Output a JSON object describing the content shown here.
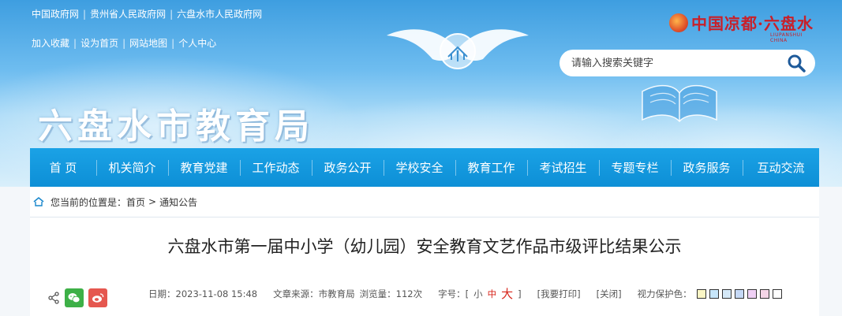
{
  "top_links": [
    "中国政府网",
    "贵州省人民政府网",
    "六盘水市人民政府网"
  ],
  "user_links": [
    "加入收藏",
    "设为首页",
    "网站地图",
    "个人中心"
  ],
  "site_title": "六盘水市教育局",
  "brand": {
    "text": "中国凉都·六盘水",
    "sub": "LIUPANSHUI CHINA"
  },
  "search": {
    "placeholder": "请输入搜索关键字"
  },
  "nav": [
    "首 页",
    "机关简介",
    "教育党建",
    "工作动态",
    "政务公开",
    "学校安全",
    "教育工作",
    "考试招生",
    "专题专栏",
    "政务服务",
    "互动交流"
  ],
  "breadcrumb": {
    "prefix": "您当前的位置是：",
    "home": "首页",
    "current": "通知公告",
    "sep": ">"
  },
  "article": {
    "title": "六盘水市第一届中小学（幼儿园）安全教育文艺作品市级评比结果公示",
    "date": "日期：2023-11-08 15:48",
    "source": "文章来源：市教育局",
    "views": "浏览量：112次",
    "font_label": "字号：[",
    "font_small": "小",
    "font_mid": "中",
    "font_big": "大",
    "font_close": "]",
    "print": "[我要打印]",
    "close": "[关闭]",
    "eye_care": "视力保护色："
  },
  "eye_colors": [
    "#fbf6c5",
    "#c7e6fa",
    "#d4e8f7",
    "#c5d8f5",
    "#efd0f5",
    "#f4d5e6",
    "#ffffff"
  ],
  "colors": {
    "nav_bg": "#0d8fd6",
    "accent_red": "#d7261c",
    "wechat": "#3db047",
    "weibo": "#e5574f"
  }
}
